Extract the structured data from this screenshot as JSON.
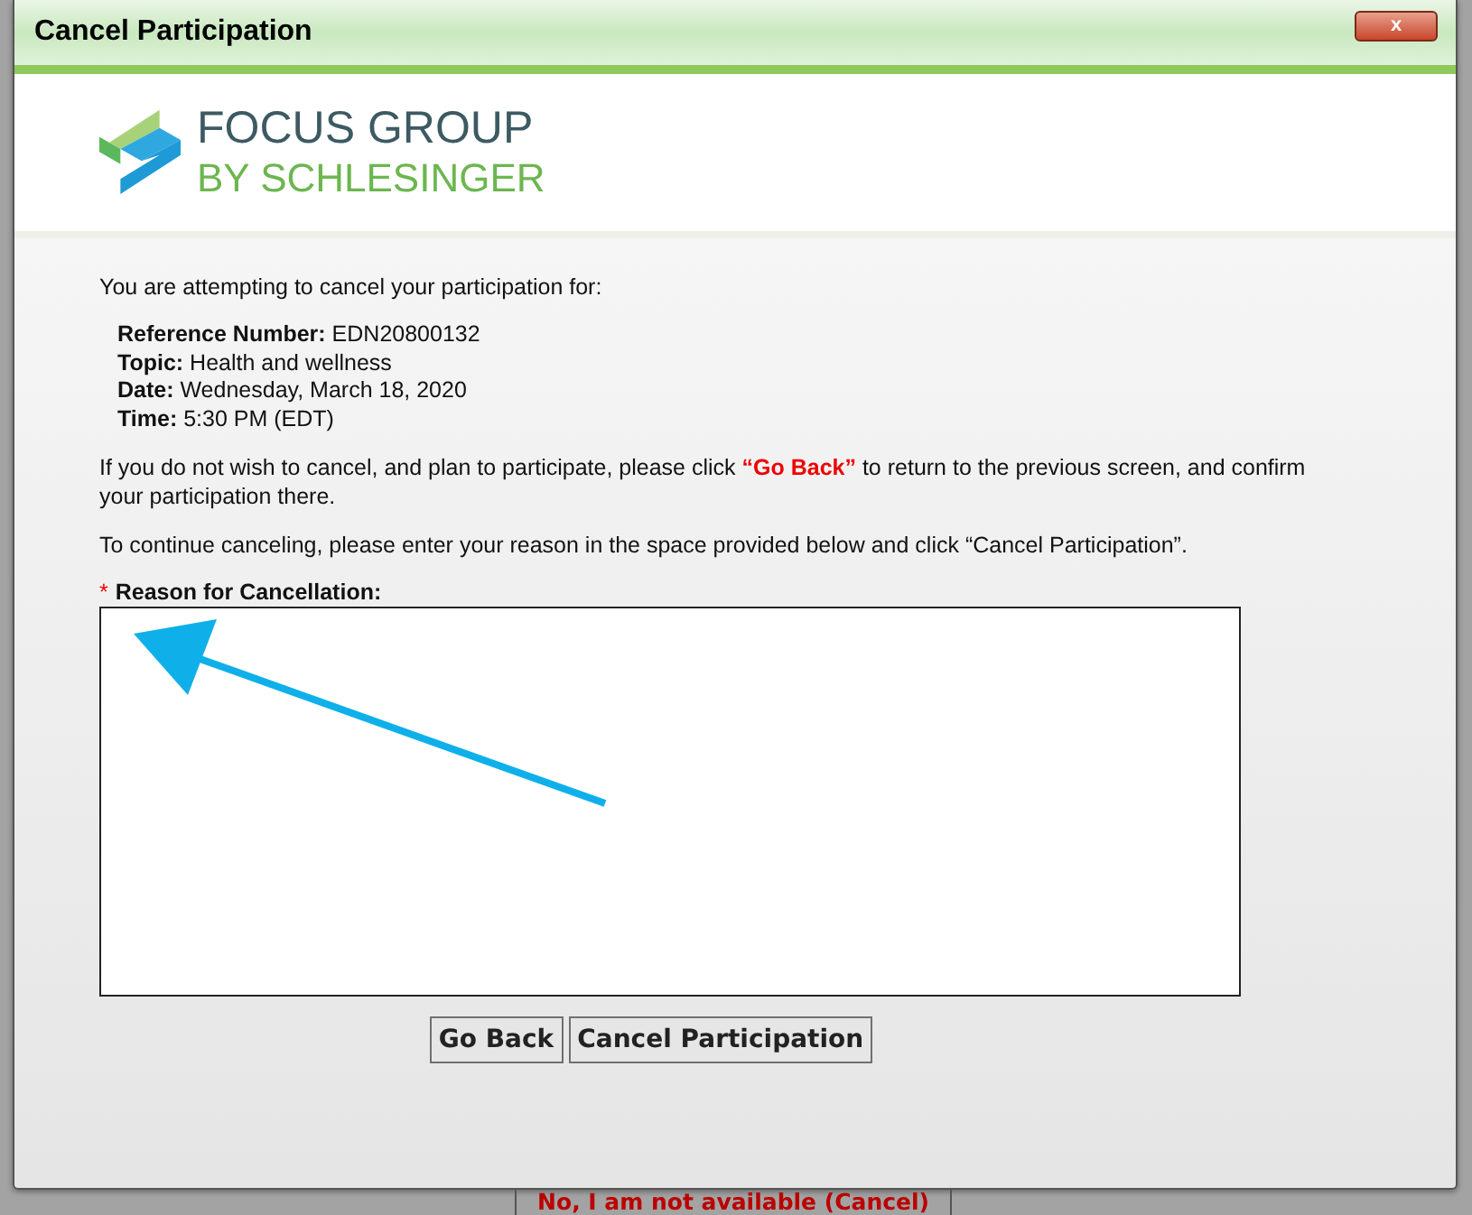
{
  "window": {
    "title": "Cancel Participation",
    "close": "x"
  },
  "logo": {
    "line_1": "FOCUS GROUP",
    "line_2": "BY SCHLESINGER"
  },
  "intro": "You are attempting to cancel your participation for:",
  "details": [
    "**Reference Number:** EDN20800132",
    "**Topic:** Health and wellness",
    "**Date:** Wednesday, March 18, 2020",
    "**Time:** 5:30 PM (EDT)"
  ],
  "notes": [
    "If you do not wish to cancel, and plan to participate, please click **“Go Back”** to return to the previous screen, and confirm your participation there.",
    "To continue canceling, please enter your reason in the space provided below and click “Cancel Participation”."
  ],
  "reason": {
    "required_mark": "*",
    "label": "Reason for Cancellation:"
  },
  "buttons": [
    "Go Back",
    "Cancel Participation"
  ],
  "behind_button": "No, I am not available (Cancel)"
}
